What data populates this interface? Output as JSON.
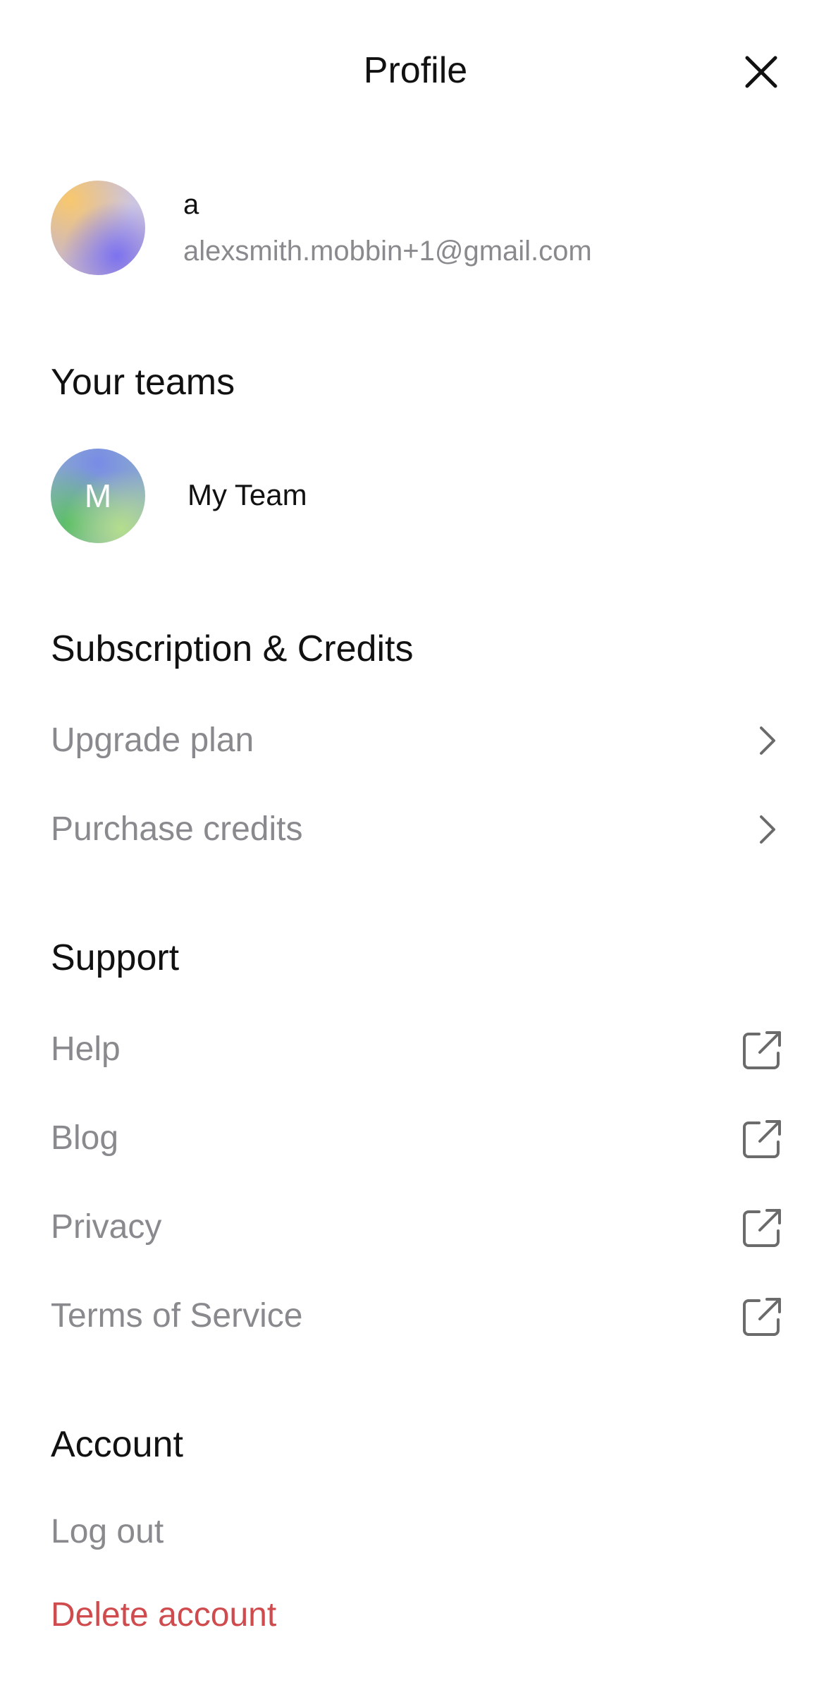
{
  "header": {
    "title": "Profile",
    "close_icon": "close-icon"
  },
  "user": {
    "name": "a",
    "email": "alexsmith.mobbin+1@gmail.com"
  },
  "teams": {
    "title": "Your teams",
    "items": [
      {
        "initial": "M",
        "name": "My Team"
      }
    ]
  },
  "subscription": {
    "title": "Subscription & Credits",
    "items": [
      {
        "label": "Upgrade plan",
        "icon": "chevron-right-icon"
      },
      {
        "label": "Purchase credits",
        "icon": "chevron-right-icon"
      }
    ]
  },
  "support": {
    "title": "Support",
    "items": [
      {
        "label": "Help",
        "icon": "external-link-icon"
      },
      {
        "label": "Blog",
        "icon": "external-link-icon"
      },
      {
        "label": "Privacy",
        "icon": "external-link-icon"
      },
      {
        "label": "Terms of Service",
        "icon": "external-link-icon"
      }
    ]
  },
  "account": {
    "title": "Account",
    "logout_label": "Log out",
    "delete_label": "Delete account"
  },
  "colors": {
    "text_primary": "#111111",
    "text_secondary": "#8a8a8e",
    "danger": "#cf4b4d",
    "icon": "#6b6b6b",
    "background": "#ffffff"
  }
}
